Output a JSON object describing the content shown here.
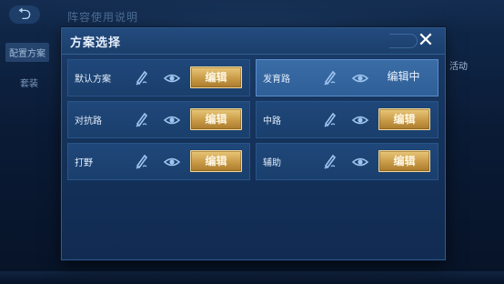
{
  "background": {
    "back_glyph": "⮌",
    "title": "阵容使用说明",
    "left_items": [
      "配置方案",
      "套装"
    ],
    "right_item": "活动"
  },
  "dialog": {
    "title": "方案选择",
    "close_glyph": "✕"
  },
  "plans": [
    {
      "name": "默认方案",
      "action": "编辑",
      "active": false
    },
    {
      "name": "发育路",
      "action": "编辑中",
      "active": true
    },
    {
      "name": "对抗路",
      "action": "编辑",
      "active": false
    },
    {
      "name": "中路",
      "action": "编辑",
      "active": false
    },
    {
      "name": "打野",
      "action": "编辑",
      "active": false
    },
    {
      "name": "辅助",
      "action": "编辑",
      "active": false
    }
  ],
  "colors": {
    "accent_gold": "#c99b47",
    "card_blue": "#1f4779",
    "active_card": "#3a6ca6"
  }
}
